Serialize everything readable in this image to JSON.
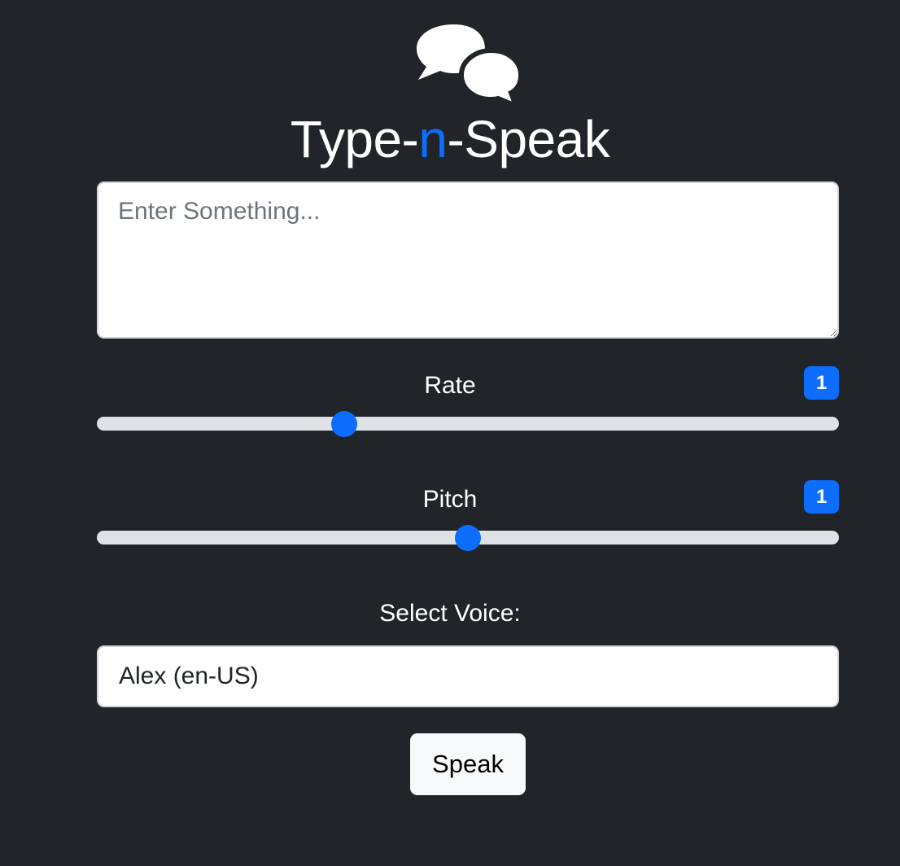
{
  "app": {
    "title_parts": [
      "Type-",
      "n",
      "-Speak"
    ],
    "accent_color": "#0d6efd",
    "logo_icon": "chat-bubbles-icon"
  },
  "text_input": {
    "placeholder": "Enter Something...",
    "value": ""
  },
  "rate": {
    "label": "Rate",
    "badge": "1",
    "min": 0.5,
    "max": 2,
    "value": 1
  },
  "pitch": {
    "label": "Pitch",
    "badge": "1",
    "min": 0,
    "max": 2,
    "value": 1
  },
  "voice": {
    "label": "Select Voice:",
    "selected": "Alex (en-US)"
  },
  "actions": {
    "speak_label": "Speak"
  }
}
